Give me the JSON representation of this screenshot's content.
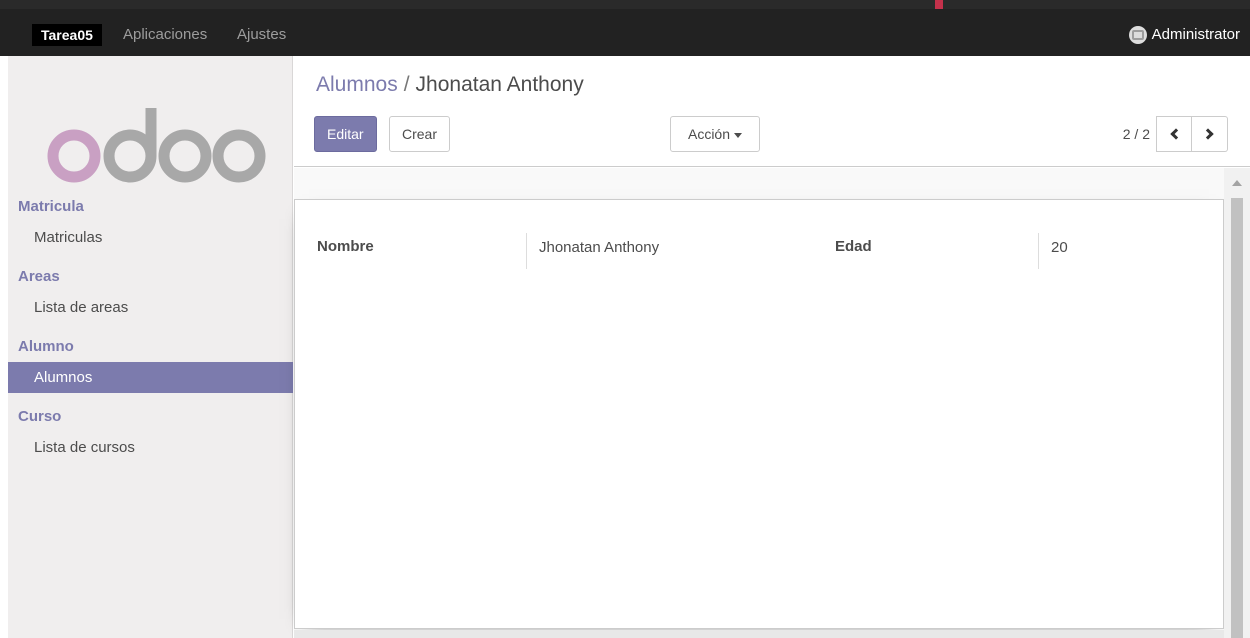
{
  "topbar": {
    "brand": "Tarea05",
    "menu": [
      {
        "label": "Aplicaciones"
      },
      {
        "label": "Ajustes"
      }
    ],
    "user_name": "Administrator"
  },
  "sidebar": {
    "logo_icon": "odoo-logo",
    "sections": [
      {
        "title": "Matricula",
        "items": [
          {
            "label": "Matriculas"
          }
        ]
      },
      {
        "title": "Areas",
        "items": [
          {
            "label": "Lista de areas"
          }
        ]
      },
      {
        "title": "Alumno",
        "items": [
          {
            "label": "Alumnos",
            "active": true
          }
        ]
      },
      {
        "title": "Curso",
        "items": [
          {
            "label": "Lista de cursos"
          }
        ]
      }
    ]
  },
  "breadcrumb": {
    "parent": "Alumnos",
    "separator": "/",
    "current": "Jhonatan Anthony"
  },
  "toolbar": {
    "edit_label": "Editar",
    "create_label": "Crear",
    "action_label": "Acción"
  },
  "pager": {
    "text": "2 / 2"
  },
  "form": {
    "fields": [
      {
        "label": "Nombre",
        "value": "Jhonatan Anthony"
      },
      {
        "label": "Edad",
        "value": "20"
      }
    ]
  },
  "colors": {
    "accent": "#7c7bad",
    "topbar": "#222222",
    "sidebar_bg": "#f0eeee"
  }
}
